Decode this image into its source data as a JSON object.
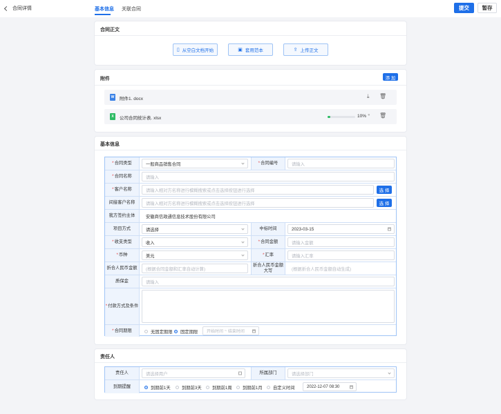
{
  "header": {
    "back_label": "合同详情",
    "tabs": [
      {
        "label": "基本信息",
        "active": true
      },
      {
        "label": "关联合同",
        "active": false
      }
    ],
    "submit_label": "提交",
    "save_label": "暂存"
  },
  "contract_body": {
    "title": "合同正文",
    "buttons": [
      {
        "label": "从空白文档开始",
        "icon": "document-icon"
      },
      {
        "label": "套用范本",
        "icon": "template-icon"
      },
      {
        "label": "上传正文",
        "icon": "upload-icon"
      }
    ]
  },
  "attachments": {
    "title": "附件",
    "add_label": "添 加",
    "files": [
      {
        "name": "附件1. docx",
        "type_glyph": "W",
        "color": "#3b82e6"
      },
      {
        "name": "公司合同统计表. xlsx",
        "type_glyph": "X",
        "color": "#2dbb64",
        "progress_percent": 10,
        "progress_text": "10%"
      }
    ]
  },
  "basic_info": {
    "title": "基本信息",
    "contract_type_label": "合同类型",
    "contract_type_value": "一般商品销售合同",
    "contract_no_label": "合同编号",
    "contract_no_placeholder": "请输入",
    "contract_name_label": "合同名称",
    "contract_name_placeholder": "请输入",
    "customer_label": "客户名称",
    "customer_placeholder": "请输入相对方名称进行模糊搜索或点击选择按钮进行选择",
    "indirect_customer_label": "间接客户名称",
    "indirect_customer_placeholder": "请输入相对方名称进行模糊搜索或点击选择按钮进行选择",
    "select_label": "选 择",
    "our_party_label": "我方签约主体",
    "our_party_value": "安徽商信政通信息技术股份有限公司",
    "project_label": "项目方式",
    "project_value": "请选择",
    "bid_time_label": "中标时间",
    "bid_time_value": "2023-03-15",
    "income_type_label": "收支类型",
    "income_type_value": "收入",
    "amount_label": "合同金额",
    "amount_placeholder": "请输入金额",
    "currency_label": "币种",
    "currency_value": "美元",
    "rate_label": "汇率",
    "rate_placeholder": "请输入汇率",
    "rmb_amount_label": "折合人民币金额",
    "rmb_amount_placeholder": "(根据合同金额和汇率自动计算)",
    "rmb_upper_label": "折合人民币金额大写",
    "rmb_upper_placeholder": "(根据折合人民币金额自动生成)",
    "deposit_label": "质保金",
    "deposit_placeholder": "请输入",
    "payment_label": "付款方式及条件",
    "period_label": "合同期限",
    "period_options": [
      "无固定期限",
      "固定期限"
    ],
    "start_placeholder": "开始时间",
    "separator": "~",
    "end_placeholder": "结束时间"
  },
  "responsible": {
    "title": "责任人",
    "person_label": "责任人",
    "person_placeholder": "请选择用户",
    "dept_label": "所属部门",
    "dept_placeholder": "请选择部门",
    "reminder_label": "到期提醒",
    "reminder_options": [
      "到期前1天",
      "到期前3天",
      "到期前1周",
      "到期前1月",
      "自定义时间"
    ],
    "reminder_selected_index": 0,
    "custom_time_value": "2022-12-07 08:30"
  }
}
